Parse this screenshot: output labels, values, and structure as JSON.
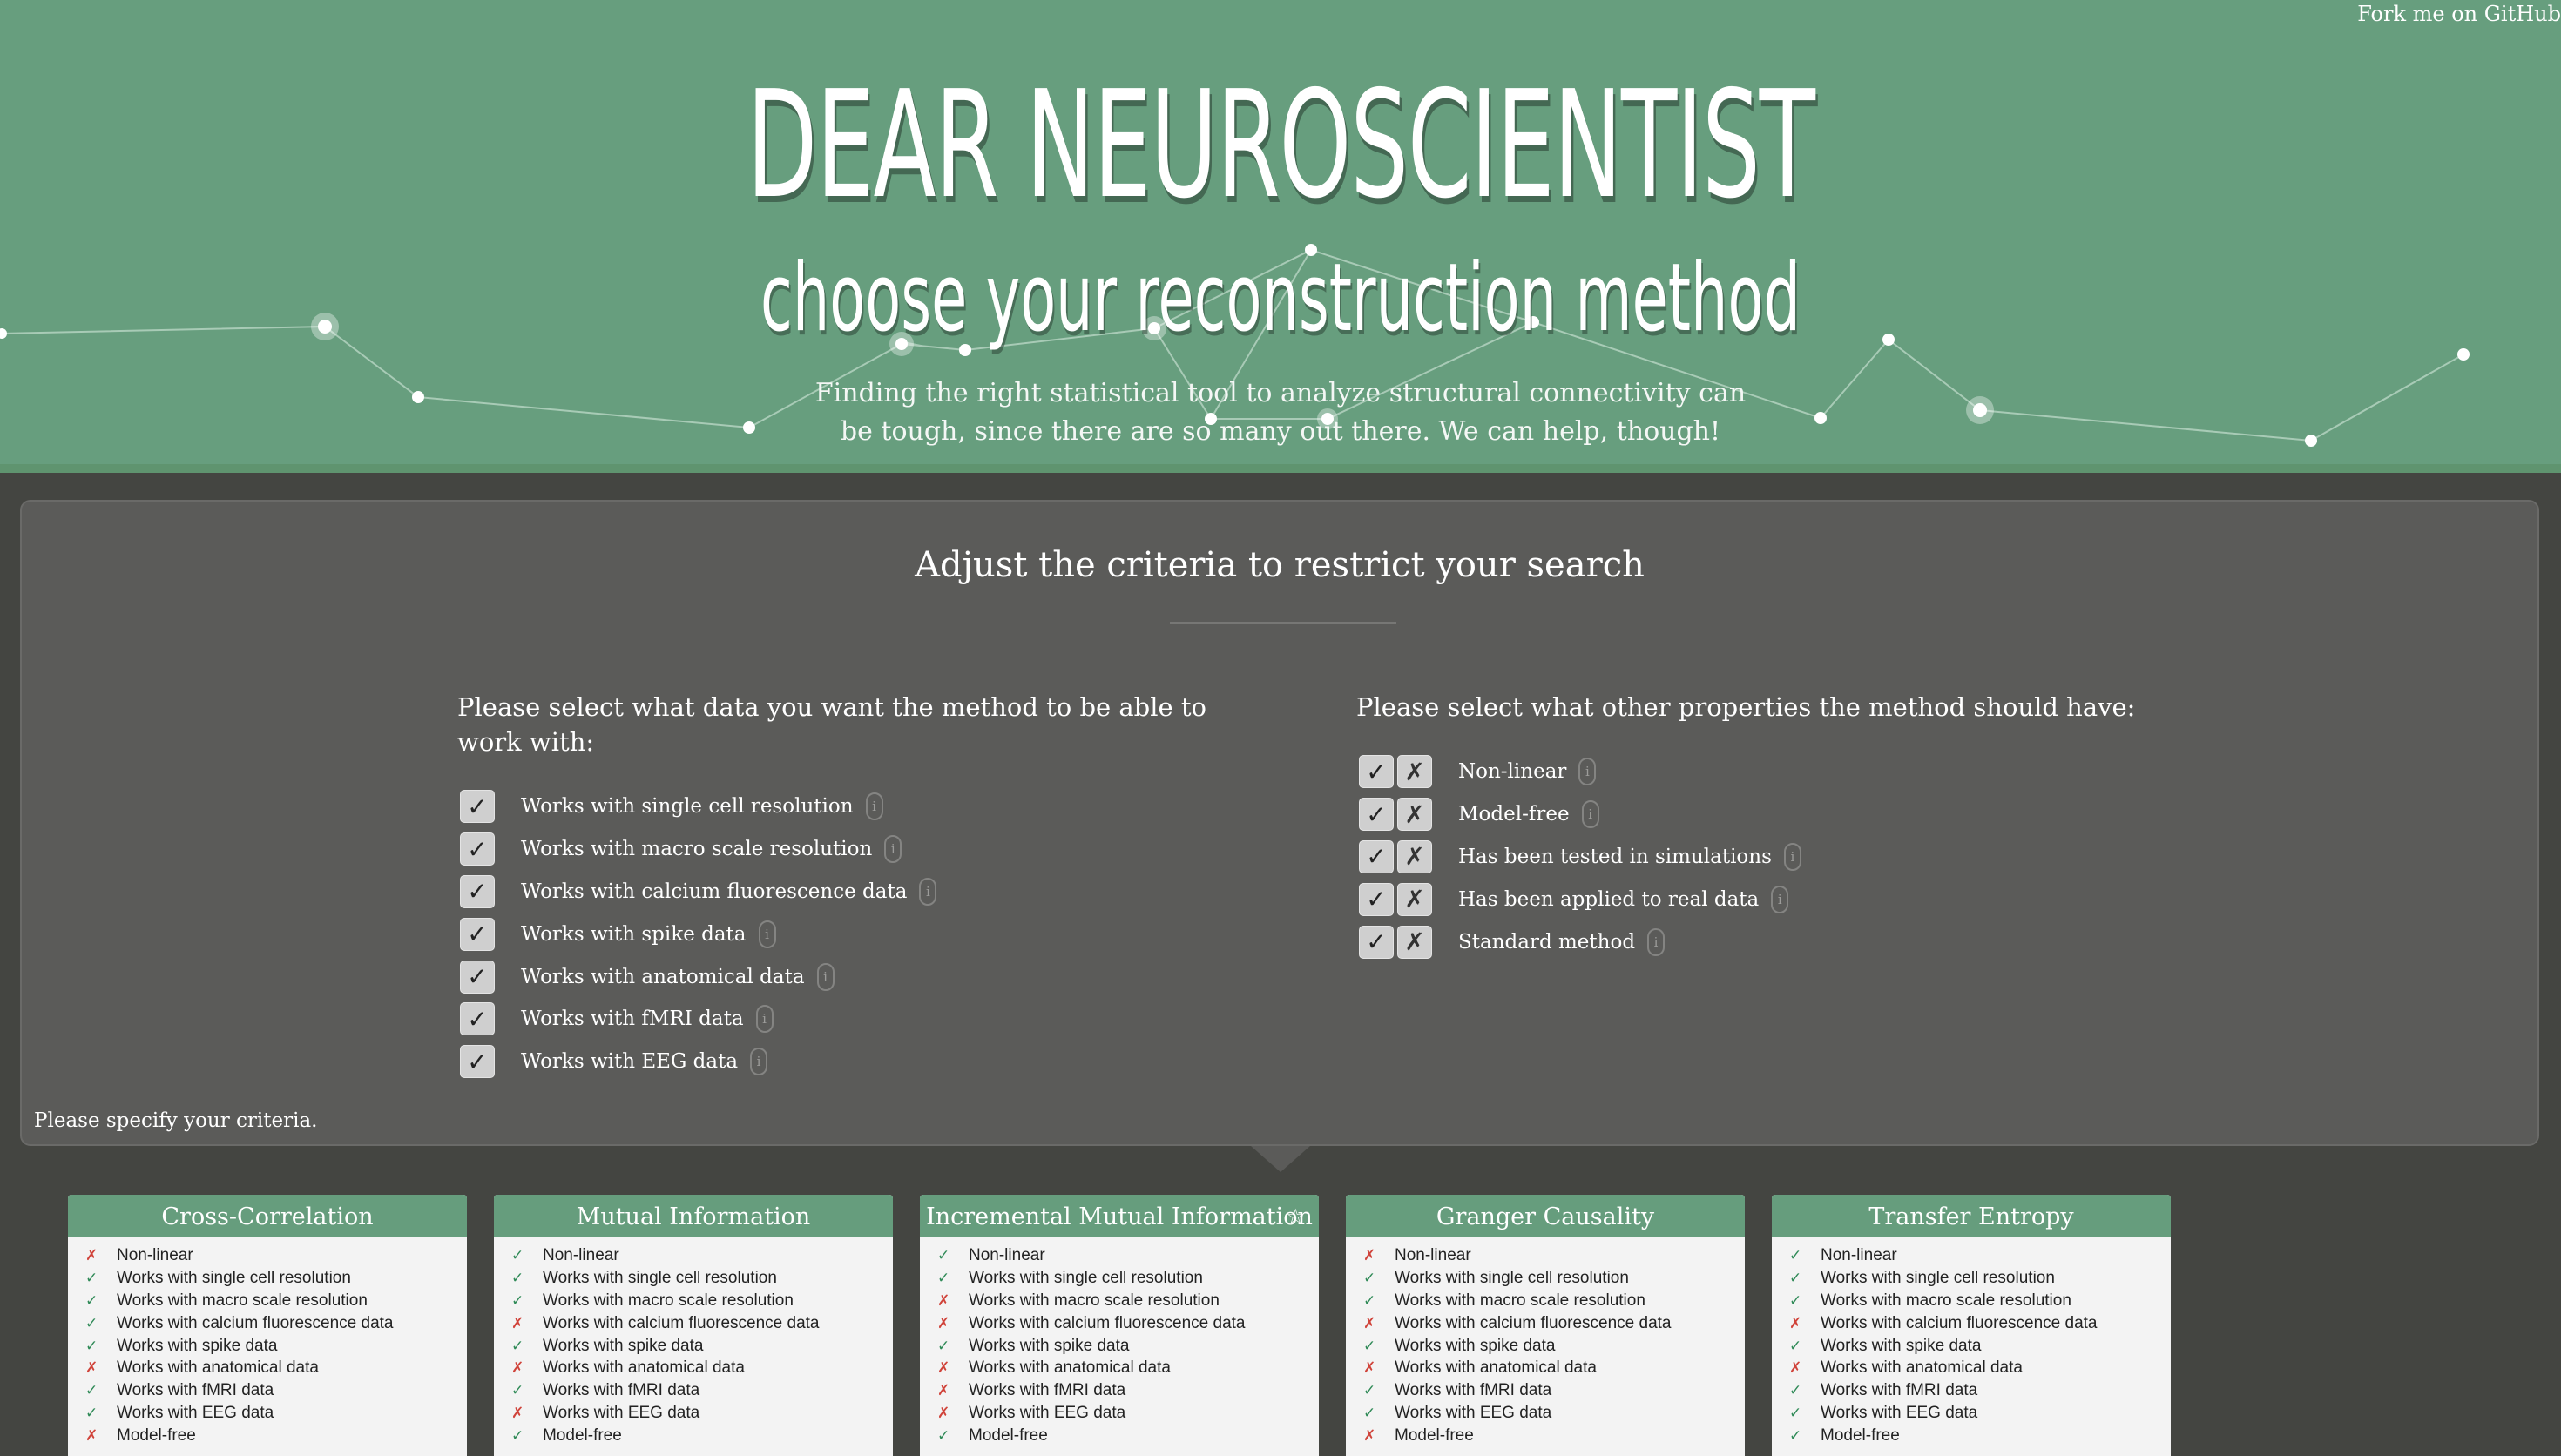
{
  "header": {
    "fork_link": "Fork me on GitHub",
    "title": "DEAR NEUROSCIENTIST",
    "subtitle": "choose your reconstruction method",
    "intro": "Finding the right statistical tool to analyze structural connectivity can be tough, since there are so many out there. We can help, though!"
  },
  "criteria": {
    "heading": "Adjust the criteria to restrict your search",
    "data_prompt": "Please select what data you want the method to be able to work with:",
    "properties_prompt": "Please select what other properties the method should have:",
    "info_icon": "i",
    "check_glyph": "✓",
    "cross_glyph": "✗",
    "data_items": [
      "Works with single cell resolution",
      "Works with macro scale resolution",
      "Works with calcium fluorescence data",
      "Works with spike data",
      "Works with anatomical data",
      "Works with fMRI data",
      "Works with EEG data"
    ],
    "property_items": [
      "Non-linear",
      "Model-free",
      "Has been tested in simulations",
      "Has been applied to real data",
      "Standard method"
    ],
    "status": "Please specify your criteria."
  },
  "feature_labels": [
    "Non-linear",
    "Works with single cell resolution",
    "Works with macro scale resolution",
    "Works with calcium fluorescence data",
    "Works with spike data",
    "Works with anatomical data",
    "Works with fMRI data",
    "Works with EEG data",
    "Model-free"
  ],
  "methods": [
    {
      "name": "Cross-Correlation",
      "starred": false,
      "features": [
        false,
        true,
        true,
        true,
        true,
        false,
        true,
        true,
        false
      ]
    },
    {
      "name": "Mutual Information",
      "starred": false,
      "features": [
        true,
        true,
        true,
        false,
        true,
        false,
        true,
        false,
        true
      ]
    },
    {
      "name": "Incremental Mutual Information",
      "starred": true,
      "features": [
        true,
        true,
        false,
        false,
        true,
        false,
        false,
        false,
        true
      ]
    },
    {
      "name": "Granger Causality",
      "starred": false,
      "features": [
        false,
        true,
        true,
        false,
        true,
        false,
        true,
        true,
        false
      ]
    },
    {
      "name": "Transfer Entropy",
      "starred": false,
      "features": [
        true,
        true,
        true,
        false,
        true,
        false,
        true,
        true,
        true
      ]
    }
  ],
  "marks": {
    "yes": "✓",
    "no": "✗",
    "star": "☆"
  },
  "colors": {
    "hero_green": "#679e7e",
    "page_dark": "#444541",
    "panel_gray": "#5b5b59",
    "card_header_green": "#669d7d",
    "check_green": "#2f8a57",
    "cross_red": "#d0433a"
  }
}
